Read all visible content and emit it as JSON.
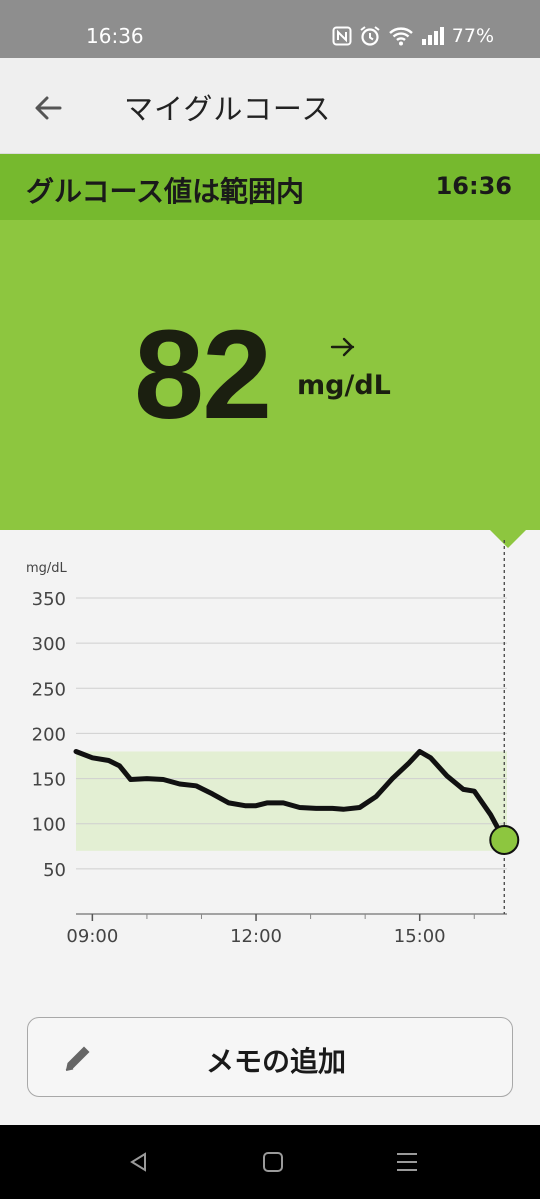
{
  "status_bar": {
    "time": "16:36",
    "battery": "77%",
    "icons": [
      "nfc-icon",
      "alarm-icon",
      "wifi-icon",
      "signal-icon"
    ]
  },
  "app_bar": {
    "title": "マイグルコース",
    "back_icon": "arrow-left-icon"
  },
  "status": {
    "label": "グルコース値は範囲内",
    "time": "16:36"
  },
  "reading": {
    "value": "82",
    "unit": "mg/dL",
    "trend_icon": "arrow-right-icon"
  },
  "colors": {
    "accent": "#8dc63f",
    "strip": "#76b92e",
    "target_band": "#e3efd3",
    "line": "#111111"
  },
  "chart_data": {
    "type": "line",
    "ylabel": "mg/dL",
    "yticks": [
      350,
      300,
      250,
      200,
      150,
      100,
      50
    ],
    "ylim": [
      0,
      350
    ],
    "xlim": [
      8.7,
      16.6
    ],
    "xticks": [
      {
        "value": 9,
        "label": "09:00"
      },
      {
        "value": 12,
        "label": "12:00"
      },
      {
        "value": 15,
        "label": "15:00"
      }
    ],
    "grid": true,
    "target_range": [
      70,
      180
    ],
    "series": [
      {
        "x": [
          8.7,
          9.0,
          9.3,
          9.5,
          9.7,
          10.0,
          10.3,
          10.6,
          10.9,
          11.2,
          11.5,
          11.8,
          12.0,
          12.2,
          12.5,
          12.8,
          13.1,
          13.4,
          13.6,
          13.9,
          14.2,
          14.5,
          14.8,
          15.0,
          15.2,
          15.5,
          15.8,
          16.0,
          16.3,
          16.55
        ],
        "values": [
          180,
          173,
          170,
          164,
          149,
          150,
          149,
          144,
          142,
          133,
          123,
          120,
          120,
          123,
          123,
          118,
          117,
          117,
          116,
          118,
          130,
          150,
          167,
          180,
          173,
          153,
          138,
          136,
          110,
          82
        ]
      }
    ],
    "current": {
      "x": 16.55,
      "value": 82
    }
  },
  "memo_button": {
    "label": "メモの追加",
    "icon": "pencil-icon"
  },
  "nav_bar": {
    "icons": [
      "back-triangle-icon",
      "home-square-icon",
      "recents-menu-icon"
    ]
  }
}
